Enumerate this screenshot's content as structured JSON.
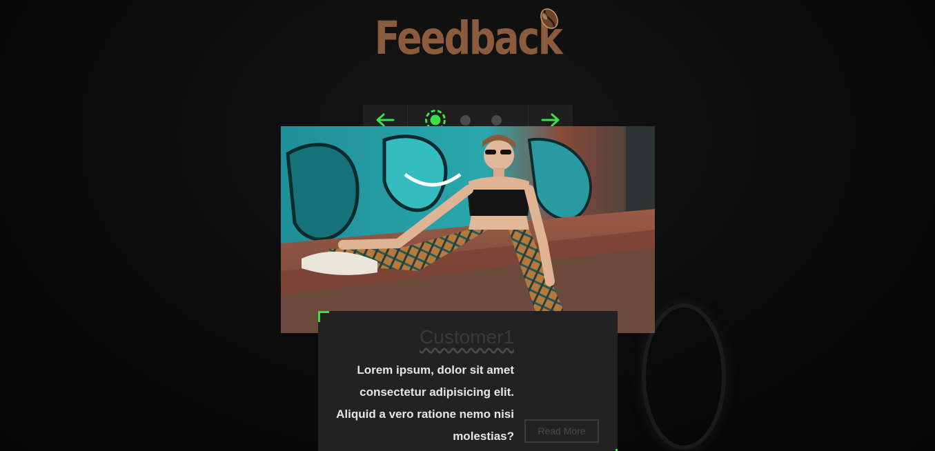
{
  "header": {
    "title": "Feedback",
    "logo_icon": "coffee-bean-icon"
  },
  "slider": {
    "prev_icon": "arrow-left-icon",
    "next_icon": "arrow-right-icon",
    "dot_count": 3,
    "active_dot": 1,
    "accent_color": "#3ee04a"
  },
  "testimonial": {
    "name": "Customer1",
    "text": "Lorem ipsum, dolor sit amet consectetur adipisicing elit. Aliquid a vero ratione nemo nisi molestias?",
    "read_more_label": "Read More"
  },
  "colors": {
    "title": "#8a5c3d",
    "card_bg": "#222222",
    "bar_bg": "#1f1f1f"
  }
}
